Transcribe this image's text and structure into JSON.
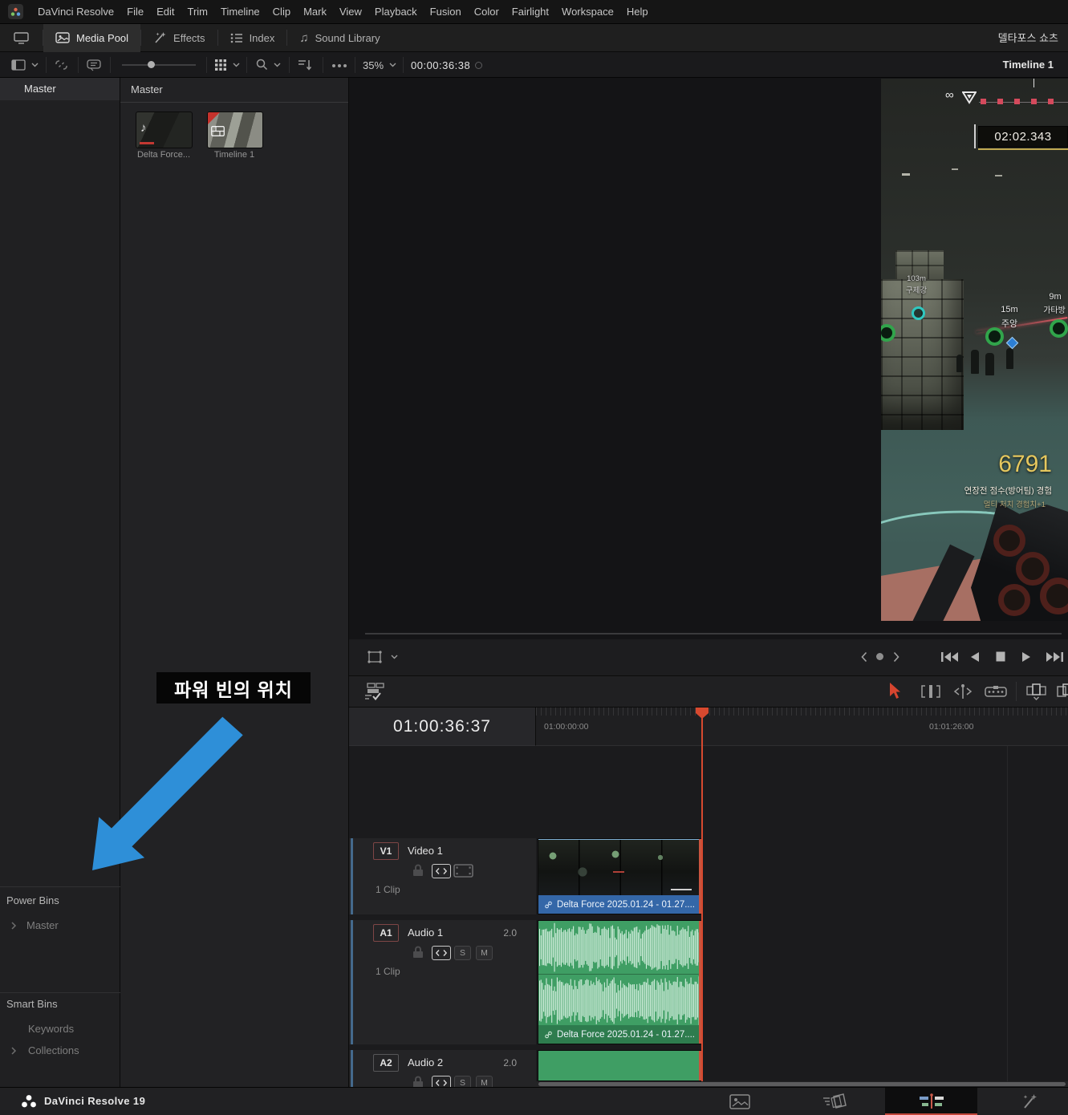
{
  "menu_bar": {
    "items": [
      "DaVinci Resolve",
      "File",
      "Edit",
      "Trim",
      "Timeline",
      "Clip",
      "Mark",
      "View",
      "Playback",
      "Fusion",
      "Color",
      "Fairlight",
      "Workspace",
      "Help"
    ]
  },
  "toolbar": {
    "media_pool_label": "Media Pool",
    "effects_label": "Effects",
    "index_label": "Index",
    "sound_library_label": "Sound Library",
    "project_title": "델타포스 쇼츠"
  },
  "media_pool_toolbar": {
    "zoom_level": "35%",
    "timecode": "00:00:36:38"
  },
  "timeline_selector": {
    "current": "Timeline 1"
  },
  "bin_sidebar": {
    "master_bin": "Master",
    "power_bins_header": "Power Bins",
    "power_bins_items": [
      {
        "label": "Master"
      }
    ],
    "smart_bins_header": "Smart Bins",
    "smart_bins_items": [
      {
        "label": "Keywords"
      },
      {
        "label": "Collections"
      }
    ]
  },
  "media_pool": {
    "bin_title": "Master",
    "clips": [
      {
        "label": "Delta Force..."
      },
      {
        "label": "Timeline 1"
      }
    ]
  },
  "viewer": {
    "hud": {
      "timer": "02:02.343",
      "score": "6791",
      "score_caption": "연장전 점수(방어팀) 경험",
      "score_note": "멀티 처치 경험치+1",
      "markers": [
        {
          "distance": "103m",
          "name": "구제강"
        },
        {
          "distance": "15m",
          "name": "주앙"
        },
        {
          "distance": "9m",
          "name": "가타방"
        }
      ]
    }
  },
  "annotation": {
    "label": "파워 빈의 위치"
  },
  "timeline": {
    "playhead_timecode": "01:00:36:37",
    "ruler_start": "01:00:00:00",
    "ruler_end": "01:01:26:00",
    "audio_controls": {
      "solo": "S",
      "mute": "M"
    },
    "tracks": [
      {
        "id": "V1",
        "name": "Video 1",
        "clip_count": "1 Clip",
        "clip_label": "Delta Force 2025.01.24 - 01.27...."
      },
      {
        "id": "A1",
        "name": "Audio 1",
        "channels": "2.0",
        "clip_count": "1 Clip",
        "clip_label": "Delta Force 2025.01.24 - 01.27...."
      },
      {
        "id": "A2",
        "name": "Audio 2",
        "channels": "2.0"
      }
    ]
  },
  "status_bar": {
    "app_version": "DaVinci Resolve 19"
  },
  "icons": {
    "infinity_glyph": "∞",
    "music_note_glyph": "♪",
    "sound_note_glyph": "♫"
  },
  "colors": {
    "playhead_red": "#d7492f",
    "clip_label_blue": "#3467a8",
    "audio_green": "#3f9e64",
    "arrow_blue": "#2e8fd8",
    "score_yellow": "#e5c75e",
    "accent_red": "#c2463a"
  }
}
